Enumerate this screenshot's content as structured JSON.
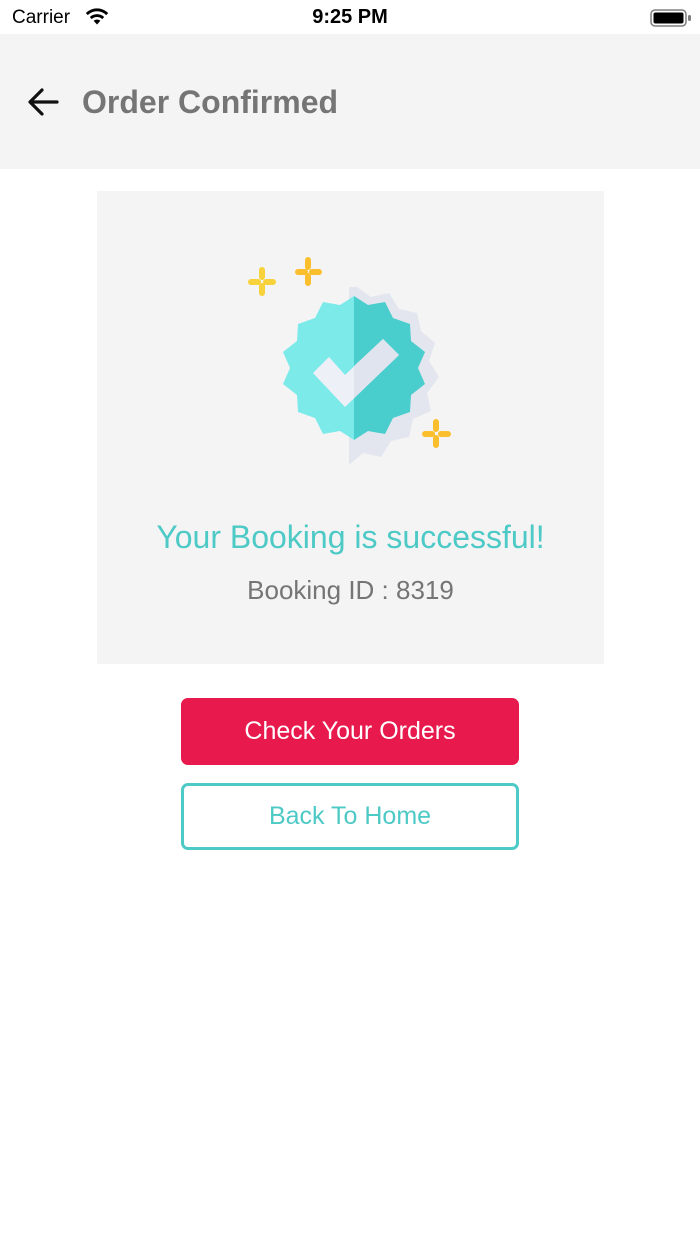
{
  "status_bar": {
    "carrier": "Carrier",
    "time": "9:25 PM",
    "icons": [
      "wifi-icon",
      "battery-icon"
    ]
  },
  "header": {
    "title": "Order Confirmed",
    "back_icon": "arrow-left-icon",
    "background": "#f4f4f4"
  },
  "confirmation": {
    "icon": "verified-badge-check-icon",
    "message": "Your Booking is successful!",
    "booking_id_text": "Booking ID : 8319"
  },
  "actions": {
    "check_orders_label": "Check Your Orders",
    "back_home_label": "Back To Home"
  },
  "colors": {
    "primary": "#e8194d",
    "accent": "#4dc9c6",
    "text_muted": "#757575",
    "sparkle": "#fbbf2d"
  }
}
